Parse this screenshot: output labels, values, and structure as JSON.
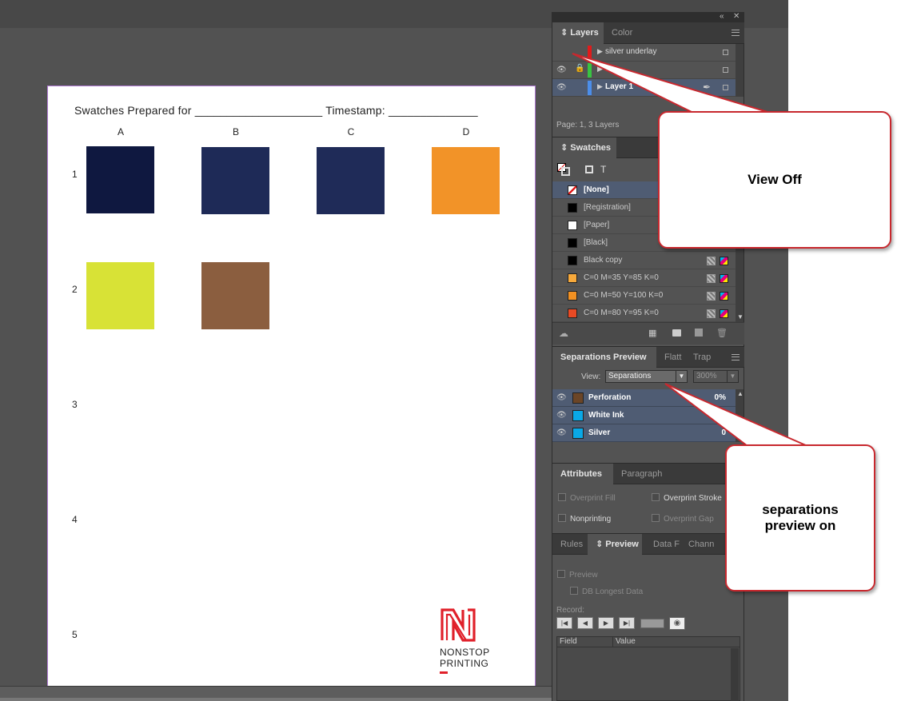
{
  "document": {
    "title": "Swatches Prepared for ____________________  Timestamp: ______________",
    "columns": [
      "A",
      "B",
      "C",
      "D"
    ],
    "rows": [
      "1",
      "2",
      "3",
      "4",
      "5"
    ],
    "swatches": {
      "r1": [
        "#0f1840",
        "#1e2a57",
        "#1f2b58",
        "#f29328"
      ],
      "r2": [
        "#d8e236",
        "#8b5e3f"
      ]
    },
    "logo": {
      "line1": "NONSTOP",
      "line2": "PRINTING",
      "color": "#e0202a"
    }
  },
  "layers_panel": {
    "tabs": [
      "Layers",
      "Color"
    ],
    "layers": [
      {
        "name": "silver underlay",
        "color": "#e01b1b"
      },
      {
        "name": "...",
        "color": "#38c442"
      },
      {
        "name": "Layer 1",
        "color": "#4c8eea"
      }
    ],
    "footer": "Page: 1, 3 Layers"
  },
  "swatches_panel": {
    "tab": "Swatches",
    "tint_label": "T",
    "items": [
      {
        "name": "[None]",
        "color": "none"
      },
      {
        "name": "[Registration]",
        "color": "#000000"
      },
      {
        "name": "[Paper]",
        "color": "#ffffff"
      },
      {
        "name": "[Black]",
        "color": "#000000"
      },
      {
        "name": "Black copy",
        "color": "#000000"
      },
      {
        "name": "C=0 M=35 Y=85 K=0",
        "color": "#f7a93b"
      },
      {
        "name": "C=0 M=50 Y=100 K=0",
        "color": "#f29122"
      },
      {
        "name": "C=0 M=80 Y=95 K=0",
        "color": "#ea4a24"
      }
    ]
  },
  "separations_panel": {
    "tabs": [
      "Separations Preview",
      "Flatt",
      "Trap"
    ],
    "view_label": "View:",
    "view_value": "Separations",
    "zoom": "300%",
    "inks": [
      {
        "name": "Perforation",
        "color": "#6b4526",
        "pct": "0%"
      },
      {
        "name": "White Ink",
        "color": "#0aa8e6",
        "pct": ""
      },
      {
        "name": "Silver",
        "color": "#0aa8e6",
        "pct": "0"
      }
    ]
  },
  "attributes_panel": {
    "tabs": [
      "Attributes",
      "Paragraph"
    ],
    "overprint_fill": "Overprint Fill",
    "overprint_stroke": "Overprint Stroke",
    "nonprinting": "Nonprinting",
    "overprint_gap": "Overprint Gap"
  },
  "preview_panel": {
    "tabs": [
      "Rules",
      "Preview",
      "Data F",
      "Chann"
    ],
    "preview": "Preview",
    "db_longest": "DB Longest Data",
    "record_label": "Record:",
    "field_col": "Field",
    "value_col": "Value"
  },
  "callouts": {
    "view_off": "View Off",
    "sep_on": "separations preview on"
  }
}
